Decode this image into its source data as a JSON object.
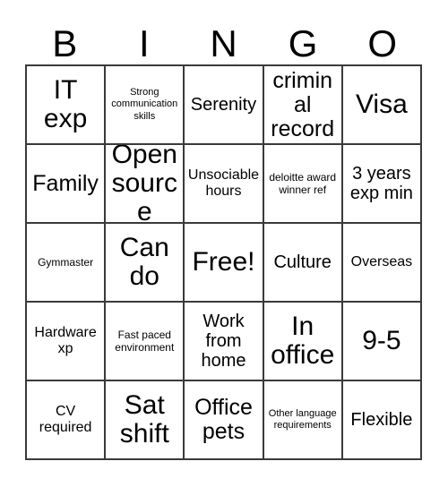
{
  "card": {
    "title_letters": [
      "B",
      "I",
      "N",
      "G",
      "O"
    ],
    "colors": {
      "background": "#ffffff",
      "border": "#3a3a3a",
      "text": "#000000"
    },
    "grid": {
      "columns": 5,
      "rows": 5,
      "free_space_index": 12
    },
    "cells": [
      {
        "text": "IT exp",
        "size": "fs-xl"
      },
      {
        "text": "Strong communication skills",
        "size": "fs-xxs"
      },
      {
        "text": "Serenity",
        "size": "fs-md"
      },
      {
        "text": "criminal record",
        "size": "fs-lg"
      },
      {
        "text": "Visa",
        "size": "fs-xl"
      },
      {
        "text": "Family",
        "size": "fs-lg"
      },
      {
        "text": "Open source",
        "size": "fs-xl"
      },
      {
        "text": "Unsociable hours",
        "size": "fs-sm"
      },
      {
        "text": "deloitte award winner ref",
        "size": "fs-xs"
      },
      {
        "text": "3 years exp min",
        "size": "fs-md"
      },
      {
        "text": "Gymmaster",
        "size": "fs-xs"
      },
      {
        "text": "Can do",
        "size": "fs-xl"
      },
      {
        "text": "Free!",
        "size": "fs-xl"
      },
      {
        "text": "Culture",
        "size": "fs-md"
      },
      {
        "text": "Overseas",
        "size": "fs-sm"
      },
      {
        "text": "Hardware xp",
        "size": "fs-sm"
      },
      {
        "text": "Fast paced environment",
        "size": "fs-xs"
      },
      {
        "text": "Work from home",
        "size": "fs-md"
      },
      {
        "text": "In office",
        "size": "fs-xl"
      },
      {
        "text": "9-5",
        "size": "fs-xl"
      },
      {
        "text": "CV required",
        "size": "fs-sm"
      },
      {
        "text": "Sat shift",
        "size": "fs-xl"
      },
      {
        "text": "Office pets",
        "size": "fs-lg"
      },
      {
        "text": "Other language requirements",
        "size": "fs-xxs"
      },
      {
        "text": "Flexible",
        "size": "fs-md"
      }
    ]
  }
}
